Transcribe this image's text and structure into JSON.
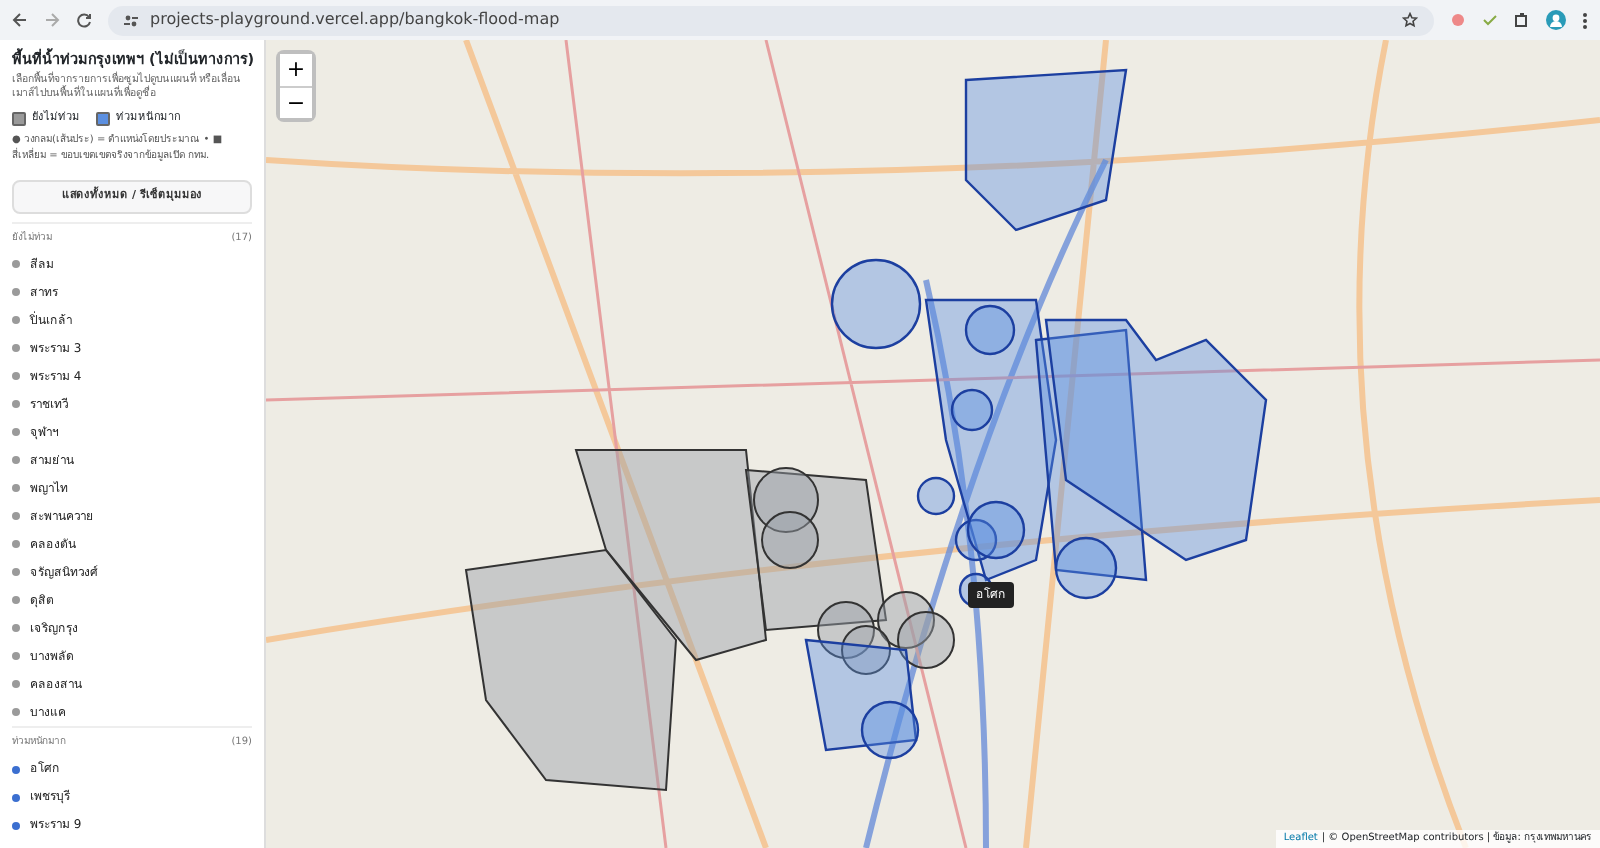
{
  "browser": {
    "url": "projects-playground.vercel.app/bangkok-flood-map"
  },
  "sidebar": {
    "title": "พื้นที่น้ำท่วมกรุงเทพฯ (ไม่เป็นทางการ)",
    "description": "เลือกพื้นที่จากรายการเพื่อซูมไปดูบนแผนที่ หรือเลื่อนเมาส์ไปบนพื้นที่ในแผนที่เพื่อดูชื่อ",
    "legend": [
      {
        "label": "ยังไม่ท่วม",
        "color": "#9a9a9a"
      },
      {
        "label": "ท่วมหนักมาก",
        "color": "#5b8fe0"
      }
    ],
    "note": "● วงกลม(เส้นประ) = ตำแหน่งโดยประมาณ • ■ สี่เหลี่ยม = ขอบเขตเขตจริงจากข้อมูลเปิด กทม.",
    "reset_button": "แสดงทั้งหมด / รีเซ็ตมุมมอง",
    "groups": [
      {
        "title": "ยังไม่ท่วม",
        "count": "(17)",
        "color": "#9a9a9a",
        "items": [
          "สีลม",
          "สาทร",
          "ปิ่นเกล้า",
          "พระราม 3",
          "พระราม 4",
          "ราชเทวี",
          "จุฬาฯ",
          "สามย่าน",
          "พญาไท",
          "สะพานควาย",
          "คลองตัน",
          "จรัญสนิทวงศ์",
          "ดุสิต",
          "เจริญกรุง",
          "บางพลัด",
          "คลองสาน",
          "บางแค"
        ]
      },
      {
        "title": "ท่วมหนักมาก",
        "count": "(19)",
        "color": "#3b6fd0",
        "items": [
          "อโศก",
          "เพชรบุรี",
          "พระราม 9"
        ]
      }
    ]
  },
  "map": {
    "zoom_in": "+",
    "zoom_out": "−",
    "tooltip": "อโศก",
    "attribution_link": "Leaflet",
    "attribution_text": "| © OpenStreetMap contributors | ข้อมูล: กรุงเทพมหานคร"
  }
}
